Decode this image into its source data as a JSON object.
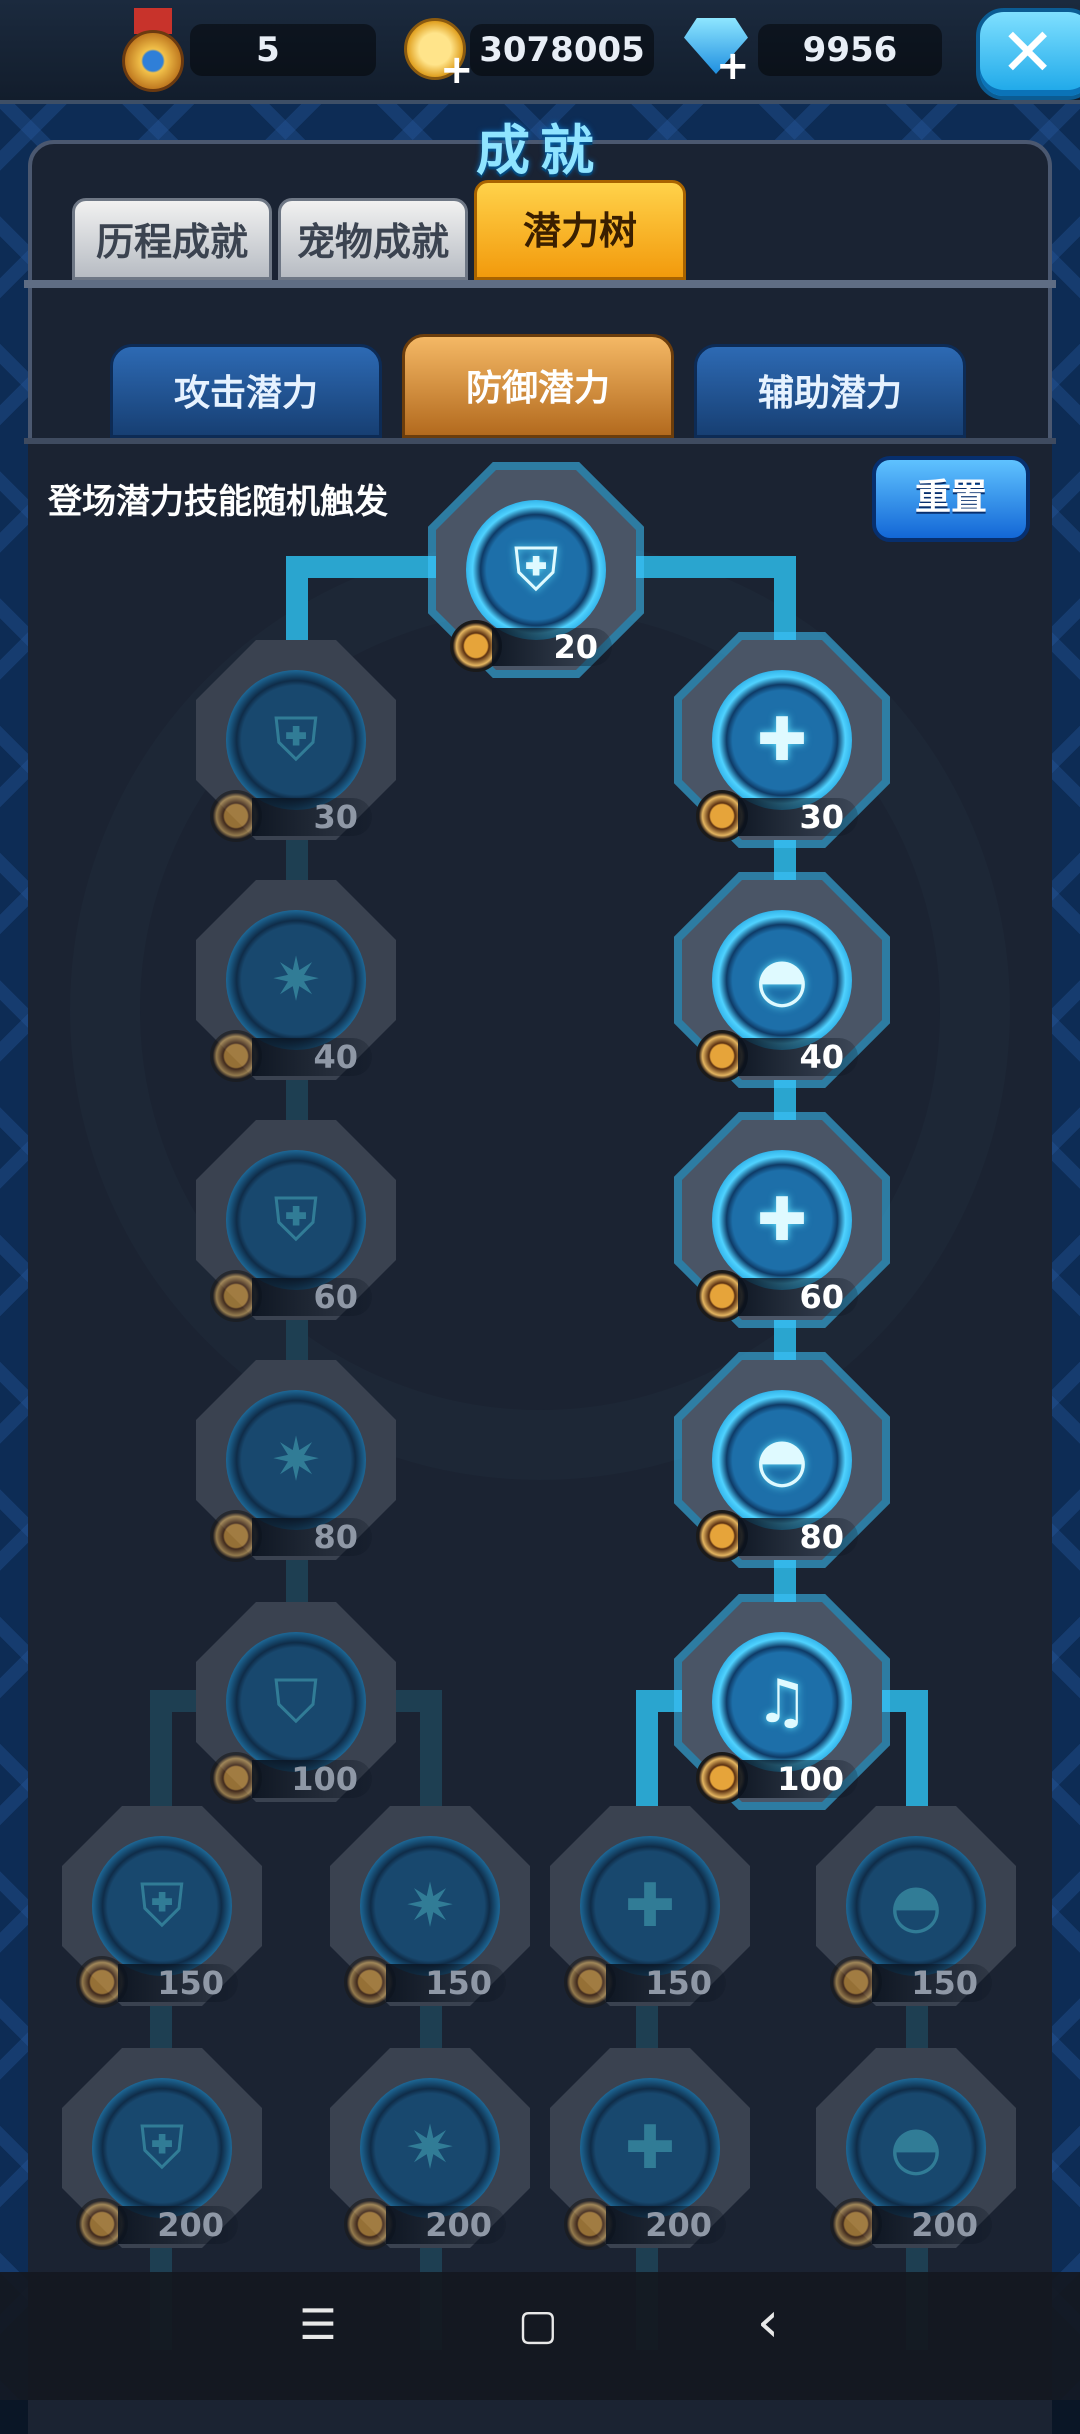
{
  "topbar": {
    "medal_count": "5",
    "gold": "3078005",
    "gems": "9956",
    "close_icon": "✕"
  },
  "title": "成就",
  "tabs": [
    {
      "label": "历程成就"
    },
    {
      "label": "宠物成就"
    },
    {
      "label": "潜力树"
    }
  ],
  "subtabs": [
    {
      "label": "攻击潜力"
    },
    {
      "label": "防御潜力"
    },
    {
      "label": "辅助潜力"
    }
  ],
  "hint": "登场潜力技能随机触发",
  "reset_label": "重置",
  "nodes": {
    "root": {
      "level": "20",
      "icon": "shield-wave-icon"
    },
    "l30": {
      "level": "30",
      "icon": "shield-star-icon"
    },
    "r30": {
      "level": "30",
      "icon": "heal-cross-icon"
    },
    "l40": {
      "level": "40",
      "icon": "burst-shield-icon"
    },
    "r40": {
      "level": "40",
      "icon": "dome-icon"
    },
    "l60": {
      "level": "60",
      "icon": "shield-star-icon"
    },
    "r60": {
      "level": "60",
      "icon": "heal-cross-icon"
    },
    "l80": {
      "level": "80",
      "icon": "burst-shield-icon"
    },
    "r80": {
      "level": "80",
      "icon": "dome-icon"
    },
    "l100": {
      "level": "100",
      "icon": "crest-shield-icon"
    },
    "r100": {
      "level": "100",
      "icon": "music-note-icon"
    },
    "a150": {
      "level": "150"
    },
    "b150": {
      "level": "150"
    },
    "c150": {
      "level": "150"
    },
    "d150": {
      "level": "150"
    },
    "a200": {
      "level": "200"
    },
    "b200": {
      "level": "200"
    },
    "c200": {
      "level": "200"
    },
    "d200": {
      "level": "200"
    }
  },
  "navbar": {
    "menu": "☰",
    "home": "▢",
    "back": "‹"
  }
}
